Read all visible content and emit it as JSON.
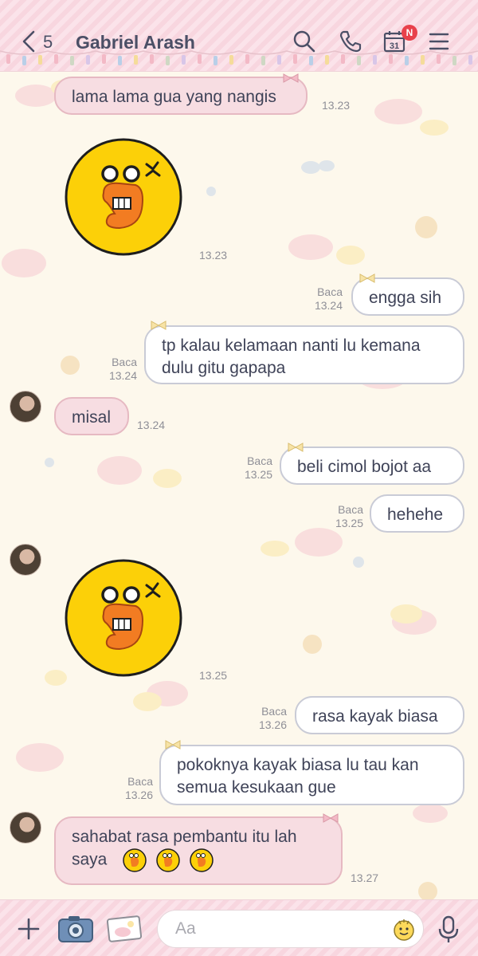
{
  "header": {
    "back_count": "5",
    "title": "Gabriel Arash",
    "calendar_day": "31",
    "badge": "N"
  },
  "messages": [
    {
      "id": "m1",
      "side": "in",
      "text": "lama lama gua yang nangis",
      "time": "13.23"
    },
    {
      "id": "m2",
      "side": "in",
      "type": "sticker",
      "sticker": "angry-duck-sticker",
      "time": "13.23"
    },
    {
      "id": "m3",
      "side": "out",
      "text": "engga sih",
      "read": "Baca",
      "time": "13.24"
    },
    {
      "id": "m4",
      "side": "out",
      "text_lines": [
        "tp kalau kelamaan nanti lu kemana",
        "dulu gitu gapapa"
      ],
      "read": "Baca",
      "time": "13.24"
    },
    {
      "id": "m5",
      "side": "in",
      "text": "misal",
      "time": "13.24"
    },
    {
      "id": "m6",
      "side": "out",
      "text": "beli cimol bojot aa",
      "read": "Baca",
      "time": "13.25"
    },
    {
      "id": "m7",
      "side": "out",
      "text": "hehehe",
      "read": "Baca",
      "time": "13.25"
    },
    {
      "id": "m8",
      "side": "in",
      "type": "sticker",
      "sticker": "angry-duck-sticker",
      "time": "13.25"
    },
    {
      "id": "m9",
      "side": "out",
      "text": "rasa kayak biasa",
      "read": "Baca",
      "time": "13.26"
    },
    {
      "id": "m10",
      "side": "out",
      "text_lines": [
        "pokoknya kayak biasa lu tau kan",
        "semua kesukaan gue"
      ],
      "read": "Baca",
      "time": "13.26"
    },
    {
      "id": "m11",
      "side": "in",
      "text_lines": [
        "sahabat rasa pembantu itu lah",
        "saya"
      ],
      "emoji_count": 3,
      "emoji": "angry-duck-emoji",
      "time": "13.27"
    }
  ],
  "footer": {
    "placeholder": "Aa"
  },
  "colors": {
    "bubble_in": "#f7dde2",
    "bubble_out": "#ffffff",
    "header_pink": "#f8d6df",
    "text": "#3f4358",
    "meta": "#8f8f97",
    "badge": "#e8414b",
    "sticker_yellow": "#fcd008",
    "sticker_orange": "#f27c22"
  }
}
